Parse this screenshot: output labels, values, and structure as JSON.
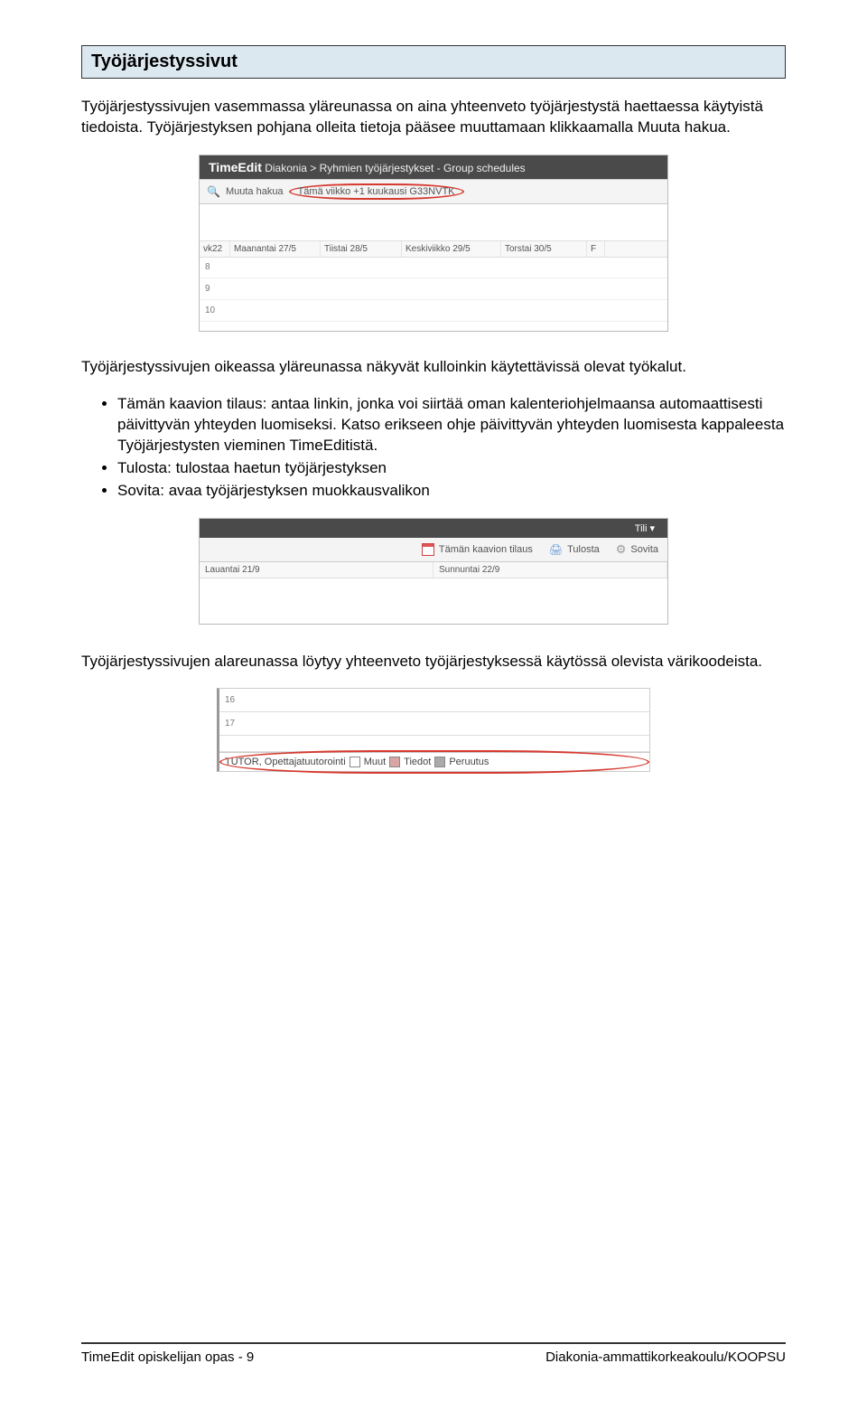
{
  "title": "Työjärjestyssivut",
  "p1": "Työjärjestyssivujen vasemmassa yläreunassa on aina yhteenveto työjärjestystä haettaessa käytyistä tiedoista. Työjärjestyksen pohjana olleita tietoja pääsee muuttamaan klikkaamalla Muuta hakua.",
  "p2": "Työjärjestyssivujen oikeassa yläreunassa näkyvät kulloinkin käytettävissä olevat työkalut.",
  "bullets": [
    "Tämän kaavion tilaus: antaa linkin, jonka voi siirtää oman kalenteriohjelmaansa automaattisesti päivittyvän yhteyden luomiseksi. Katso erikseen ohje päivittyvän yhteyden luomisesta kappaleesta Työjärjestysten vieminen TimeEditistä.",
    "Tulosta: tulostaa haetun työjärjestyksen",
    "Sovita: avaa työjärjestyksen muokkausvalikon"
  ],
  "p3": "Työjärjestyssivujen alareunassa löytyy yhteenveto työjärjestyksessä käytössä olevista värikoodeista.",
  "shot1": {
    "brand": "TimeEdit",
    "bread": "Diakonia > Ryhmien työjärjestykset - Group schedules",
    "muuta": "Muuta hakua",
    "oval": "Tämä viikko +1 kuukausi G33NVTK",
    "wk": "vk22",
    "days": [
      "Maanantai 27/5",
      "Tiistai 28/5",
      "Keskiviikko 29/5",
      "Torstai 30/5",
      "F"
    ],
    "hours": [
      "8",
      "9",
      "10"
    ]
  },
  "shot2": {
    "tili": "Tili ▾",
    "tool1": "Tämän kaavion tilaus",
    "tool2": "Tulosta",
    "tool3": "Sovita",
    "d1": "Lauantai 21/9",
    "d2": "Sunnuntai 22/9"
  },
  "shot3": {
    "rows": [
      "16",
      "17"
    ],
    "legend": {
      "l1": "TUTOR, Opettajatuutorointi",
      "l2": "Muut",
      "l3": "Tiedot",
      "l4": "Peruutus"
    }
  },
  "footer": {
    "left": "TimeEdit opiskelijan opas - 9",
    "right": "Diakonia-ammattikorkeakoulu/KOOPSU"
  }
}
